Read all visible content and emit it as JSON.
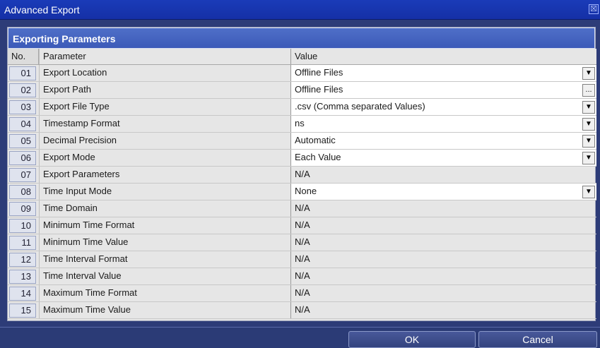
{
  "window": {
    "title": "Advanced Export"
  },
  "panel": {
    "title": "Exporting Parameters"
  },
  "table": {
    "headers": {
      "no": "No.",
      "parameter": "Parameter",
      "value": "Value"
    },
    "rows": [
      {
        "no": "01",
        "parameter": "Export Location",
        "value": "Offline Files",
        "control": "dropdown"
      },
      {
        "no": "02",
        "parameter": "Export Path",
        "value": "Offline Files",
        "control": "browse"
      },
      {
        "no": "03",
        "parameter": "Export File Type",
        "value": ".csv (Comma separated Values)",
        "control": "dropdown"
      },
      {
        "no": "04",
        "parameter": "Timestamp Format",
        "value": "ns",
        "control": "dropdown"
      },
      {
        "no": "05",
        "parameter": "Decimal Precision",
        "value": "Automatic",
        "control": "dropdown"
      },
      {
        "no": "06",
        "parameter": "Export Mode",
        "value": "Each Value",
        "control": "dropdown"
      },
      {
        "no": "07",
        "parameter": "Export Parameters",
        "value": "N/A",
        "control": "none"
      },
      {
        "no": "08",
        "parameter": "Time Input Mode",
        "value": "None",
        "control": "dropdown"
      },
      {
        "no": "09",
        "parameter": "Time Domain",
        "value": "N/A",
        "control": "none"
      },
      {
        "no": "10",
        "parameter": "Minimum Time Format",
        "value": "N/A",
        "control": "none"
      },
      {
        "no": "11",
        "parameter": "Minimum Time Value",
        "value": "N/A",
        "control": "none"
      },
      {
        "no": "12",
        "parameter": "Time Interval Format",
        "value": "N/A",
        "control": "none"
      },
      {
        "no": "13",
        "parameter": "Time Interval Value",
        "value": "N/A",
        "control": "none"
      },
      {
        "no": "14",
        "parameter": "Maximum Time Format",
        "value": "N/A",
        "control": "none"
      },
      {
        "no": "15",
        "parameter": "Maximum Time Value",
        "value": "N/A",
        "control": "none"
      }
    ]
  },
  "icons": {
    "dropdown": "chevron-down-icon",
    "browse": "ellipsis-icon",
    "close": "close-icon"
  },
  "glyphs": {
    "dropdown": "▼",
    "browse": "...",
    "close": "☒"
  },
  "buttons": {
    "ok": "OK",
    "cancel": "Cancel"
  }
}
